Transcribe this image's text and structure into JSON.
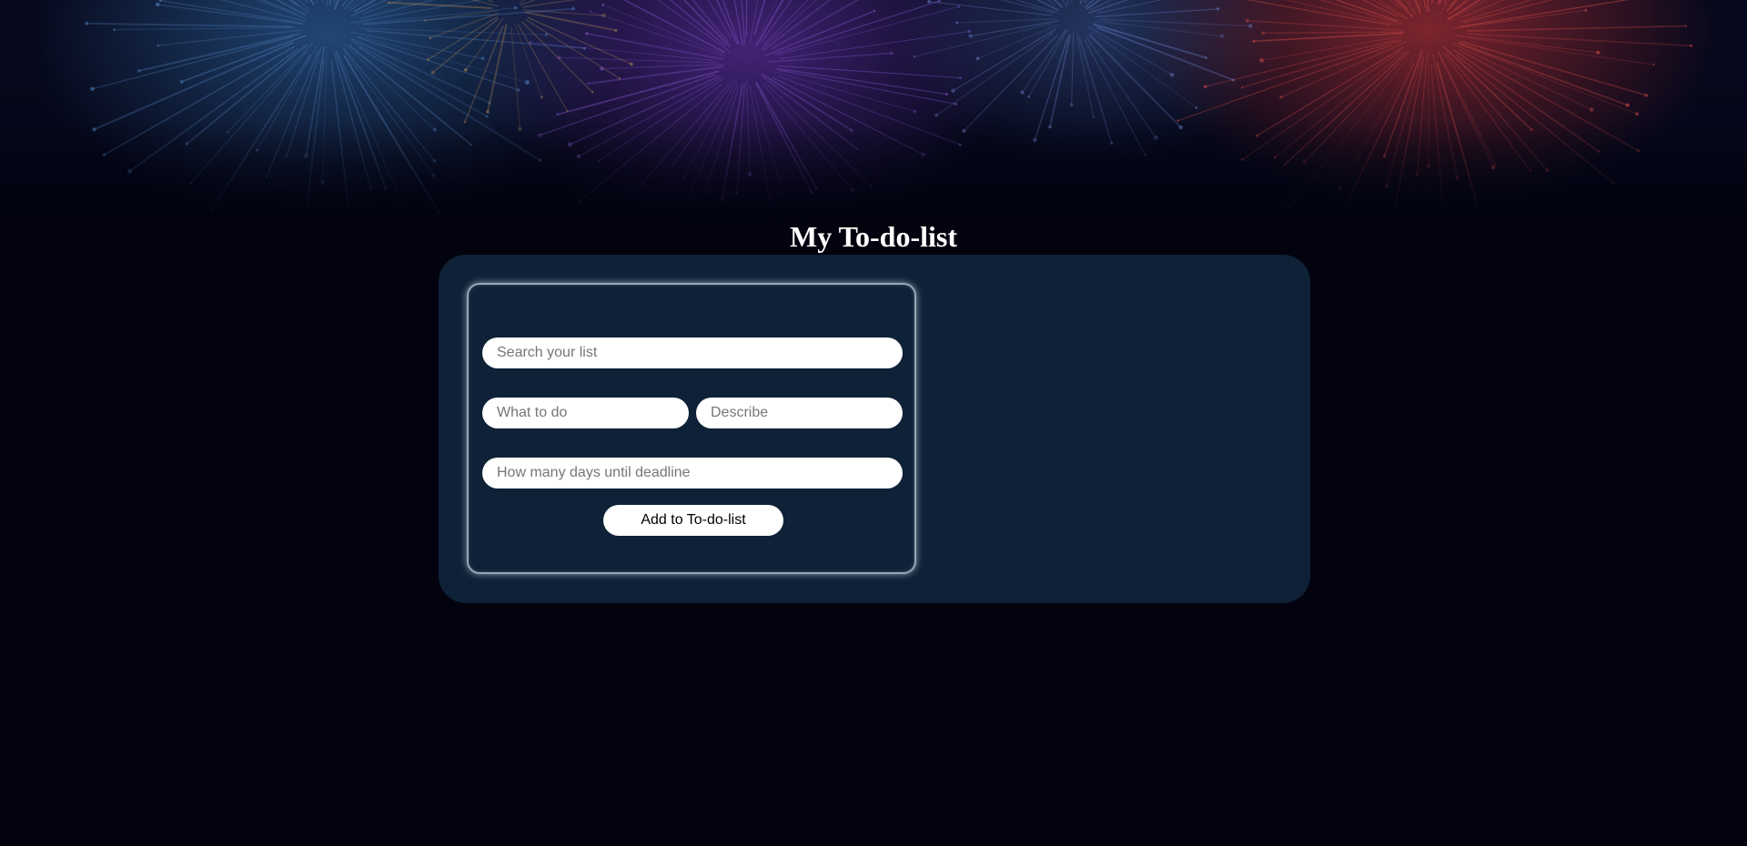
{
  "header": {
    "title": "My To-do-list"
  },
  "form": {
    "search_placeholder": "Search your list",
    "todo_placeholder": "What to do",
    "describe_placeholder": "Describe",
    "deadline_placeholder": "How many days until deadline",
    "add_button_label": "Add to To-do-list"
  },
  "colors": {
    "background": "#02030f",
    "panel": "#0e2137",
    "title": "#ffffff",
    "input": "#ffffff"
  },
  "icons": {
    "banner": "fireworks-banner"
  }
}
